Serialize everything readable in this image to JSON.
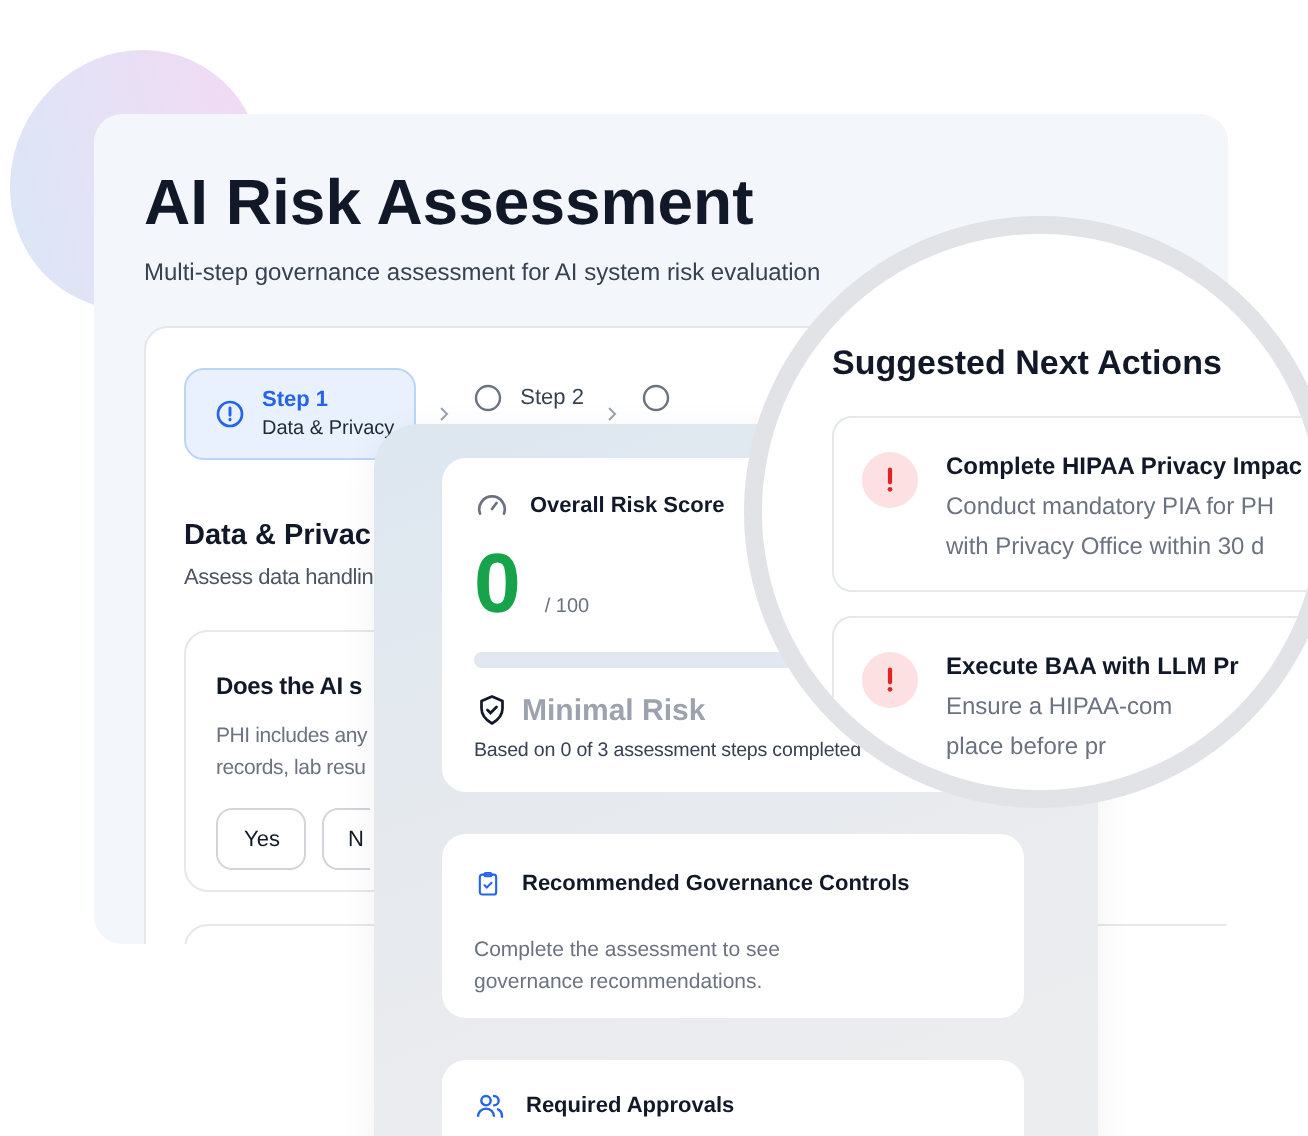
{
  "assessment": {
    "title": "AI Risk Assessment",
    "subtitle": "Multi-step governance assessment for AI system risk evaluation",
    "steps": [
      {
        "label": "Step 1",
        "sublabel": "Data & Privacy",
        "selected": true
      },
      {
        "label": "Step 2",
        "selected": false
      },
      {
        "selected": false
      }
    ],
    "section": {
      "title": "Data & Privac",
      "description": "Assess data handlin"
    },
    "question": {
      "title": "Does the AI s",
      "help_lines": [
        "PHI includes any",
        "records, lab resu"
      ],
      "answers": [
        {
          "label": "Yes"
        },
        {
          "label": "N"
        }
      ]
    }
  },
  "risk_panel": {
    "score_card": {
      "title": "Overall Risk Score",
      "score": "0",
      "max": "/ 100",
      "level": 0,
      "rating": "Minimal Risk",
      "basis": "Based on 0 of 3 assessment steps completed"
    },
    "governance": {
      "title": "Recommended Governance Controls",
      "text": "Complete the assessment to see governance recommendations."
    },
    "approvals": {
      "title": "Required Approvals"
    }
  },
  "next_actions": {
    "title": "Suggested Next Actions",
    "items": [
      {
        "title": "Complete HIPAA Privacy Impac",
        "lines": [
          "Conduct mandatory PIA for PH",
          "with Privacy Office within 30 d"
        ]
      },
      {
        "title": "Execute BAA with LLM Pr",
        "lines": [
          "Ensure a HIPAA-com",
          "place before pr"
        ]
      }
    ]
  }
}
